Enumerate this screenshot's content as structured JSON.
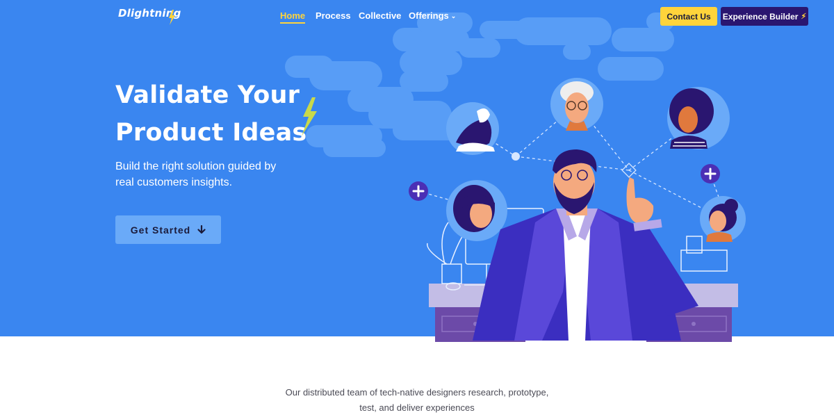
{
  "brand": {
    "name": "Dlightning",
    "logo_icon": "lightning-bolt-icon"
  },
  "nav": {
    "items": [
      {
        "label": "Home",
        "active": true
      },
      {
        "label": "Process",
        "active": false
      },
      {
        "label": "Collective",
        "active": false
      },
      {
        "label": "Offerings",
        "active": false,
        "has_dropdown": true
      }
    ],
    "dropdown_icon": "chevron-down-icon"
  },
  "header_actions": {
    "contact_label": "Contact Us",
    "builder_label": "Experience Builder",
    "builder_icon": "lightning-bolt-icon"
  },
  "hero": {
    "title": "Validate Your Product Ideas",
    "subtitle": "Build the right solution guided by real customers insights.",
    "cta_label": "Get Started",
    "cta_icon": "arrow-down-icon"
  },
  "intro": {
    "text": "Our distributed team of tech-native designers research, prototype, test, and deliver experiences"
  },
  "colors": {
    "hero_bg": "#3a86f0",
    "accent_yellow": "#ffd43b",
    "deep_purple": "#2a1670",
    "cta_bg": "#6aaaf8"
  }
}
